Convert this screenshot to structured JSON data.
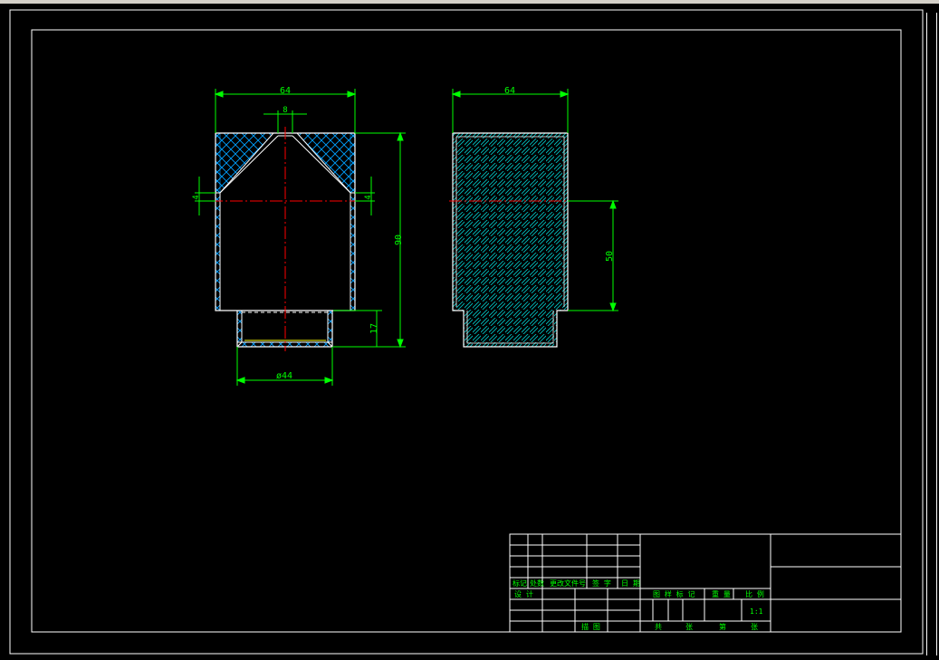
{
  "colors": {
    "background": "#000000",
    "outline": "#ffffff",
    "dimension": "#00ff00",
    "hatch_cross": "#00a0ff",
    "hatch_diag": "#00c8c8",
    "centerline": "#ff0000",
    "thread": "#ffff00"
  },
  "front_view": {
    "dim_width": "64",
    "dim_top_hole": "8",
    "dim_left_step": "4",
    "dim_right_step": "4",
    "dim_height": "90",
    "dim_tail": "17",
    "dim_tail_dia": "ø44"
  },
  "side_view": {
    "dim_width": "64",
    "dim_mid": "50"
  },
  "title_block": {
    "rev_row_labels": [
      "标记",
      "处数",
      "更改文件号",
      "签 字",
      "日 期"
    ],
    "design": "设 计",
    "check_label": "描 图",
    "stage_label": "图 样 标 记",
    "weight_label": "重 量",
    "scale_label": "比 例",
    "scale_value": "1:1",
    "total_label": "共",
    "sheet_label": "张",
    "page_label": "第",
    "page_sheet_label": "张"
  }
}
